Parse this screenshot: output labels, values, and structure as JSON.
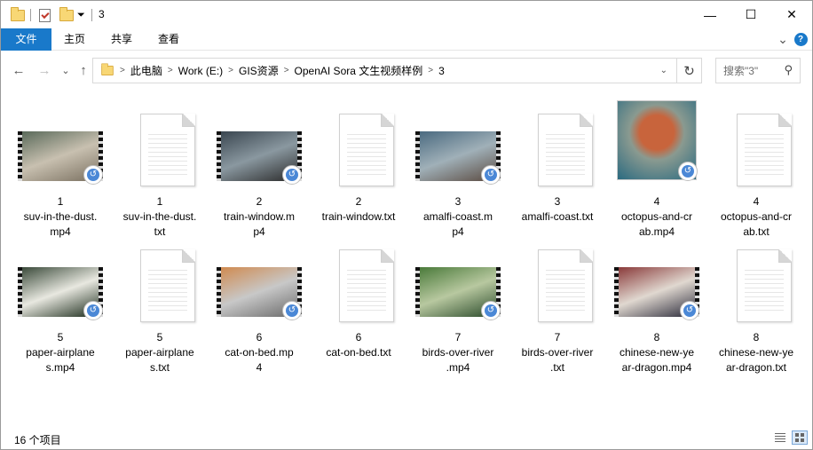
{
  "window": {
    "title": "3",
    "minimize_label": "—",
    "maximize_label": "☐",
    "close_label": "✕"
  },
  "ribbon": {
    "tabs": [
      "文件",
      "主页",
      "共享",
      "查看"
    ],
    "expand_icon": "⌄",
    "help_icon": "?"
  },
  "nav": {
    "back_icon": "←",
    "forward_icon": "→",
    "recent_icon": "⌄",
    "up_icon": "↑"
  },
  "address": {
    "crumbs": [
      "此电脑",
      "Work (E:)",
      "GIS资源",
      "OpenAI Sora 文生视频样例",
      "3"
    ],
    "separator": ">",
    "dropdown_icon": "⌄",
    "refresh_icon": "↻"
  },
  "search": {
    "placeholder": "搜索\"3\"",
    "icon": "⚲"
  },
  "files": [
    {
      "kind": "video",
      "line1": "1",
      "line2": "suv-in-the-dust.",
      "line3": "mp4",
      "colors": [
        "#5a6a5a",
        "#c8c0b0",
        "#7a7060"
      ]
    },
    {
      "kind": "text",
      "line1": "1",
      "line2": "suv-in-the-dust.",
      "line3": "txt"
    },
    {
      "kind": "video",
      "line1": "2",
      "line2": "train-window.m",
      "line3": "p4",
      "colors": [
        "#3a4650",
        "#8a98a0",
        "#2a2a2a"
      ]
    },
    {
      "kind": "text",
      "line1": "2",
      "line2": "train-window.txt",
      "line3": ""
    },
    {
      "kind": "video",
      "line1": "3",
      "line2": "amalfi-coast.m",
      "line3": "p4",
      "colors": [
        "#4a6a80",
        "#a0b0b8",
        "#5a4a40"
      ]
    },
    {
      "kind": "text",
      "line1": "3",
      "line2": "amalfi-coast.txt",
      "line3": ""
    },
    {
      "kind": "photo",
      "line1": "4",
      "line2": "octopus-and-cr",
      "line3": "ab.mp4",
      "colors": [
        "#c8643c",
        "#2a6a80",
        "#8a9a90"
      ]
    },
    {
      "kind": "text",
      "line1": "4",
      "line2": "octopus-and-cr",
      "line3": "ab.txt"
    },
    {
      "kind": "video",
      "line1": "5",
      "line2": "paper-airplane",
      "line3": "s.mp4",
      "colors": [
        "#3a4a3a",
        "#e8e8e0",
        "#1a2a1a"
      ]
    },
    {
      "kind": "text",
      "line1": "5",
      "line2": "paper-airplane",
      "line3": "s.txt"
    },
    {
      "kind": "video",
      "line1": "6",
      "line2": "cat-on-bed.mp",
      "line3": "4",
      "colors": [
        "#d08a50",
        "#c8c8c8",
        "#6a6a6a"
      ]
    },
    {
      "kind": "text",
      "line1": "6",
      "line2": "cat-on-bed.txt",
      "line3": ""
    },
    {
      "kind": "video",
      "line1": "7",
      "line2": "birds-over-river",
      "line3": ".mp4",
      "colors": [
        "#4a7a3a",
        "#b8c8a0",
        "#2a4a2a"
      ]
    },
    {
      "kind": "text",
      "line1": "7",
      "line2": "birds-over-river",
      "line3": ".txt"
    },
    {
      "kind": "video",
      "line1": "8",
      "line2": "chinese-new-ye",
      "line3": "ar-dragon.mp4",
      "colors": [
        "#8a3a3a",
        "#e0d8d0",
        "#2a2a3a"
      ]
    },
    {
      "kind": "text",
      "line1": "8",
      "line2": "chinese-new-ye",
      "line3": "ar-dragon.txt"
    }
  ],
  "badge_icon": "↺",
  "status": {
    "count": "16 个项目"
  }
}
